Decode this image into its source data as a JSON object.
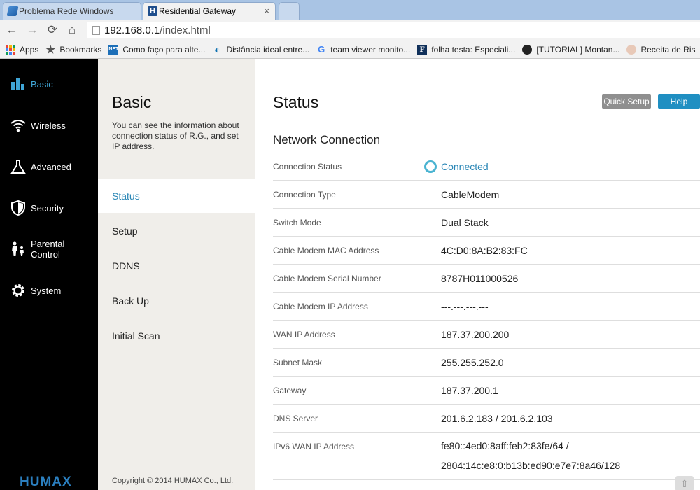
{
  "browser": {
    "tabs": [
      {
        "title": "Problema Rede Windows"
      },
      {
        "title": "Residential Gateway"
      }
    ],
    "url_host": "192.168.0.1",
    "url_path": "/index.html",
    "bookmarks": [
      {
        "label": "Apps"
      },
      {
        "label": "Bookmarks"
      },
      {
        "label": "Como faço para alte..."
      },
      {
        "label": "Distância ideal entre..."
      },
      {
        "label": "team viewer monito..."
      },
      {
        "label": "folha testa: Especiali..."
      },
      {
        "label": "[TUTORIAL] Montan..."
      },
      {
        "label": "Receita de Ris"
      }
    ],
    "nav_icons": {
      "back": "←",
      "forward": "→",
      "reload": "⟳",
      "home": "⌂",
      "close": "×"
    }
  },
  "sidebar": {
    "items": [
      {
        "label": "Basic",
        "icon": "bar-chart-icon"
      },
      {
        "label": "Wireless",
        "icon": "wifi-icon"
      },
      {
        "label": "Advanced",
        "icon": "flask-icon"
      },
      {
        "label": "Security",
        "icon": "shield-icon"
      },
      {
        "label": "Parental Control",
        "icon": "family-icon"
      },
      {
        "label": "System",
        "icon": "gear-icon"
      }
    ],
    "logo": "HUMAX",
    "active_color": "#3fa5d6"
  },
  "subnav": {
    "title": "Basic",
    "description": "You can see the information about connection status of R.G., and set IP address.",
    "items": [
      {
        "label": "Status"
      },
      {
        "label": "Setup"
      },
      {
        "label": "DDNS"
      },
      {
        "label": "Back Up"
      },
      {
        "label": "Initial Scan"
      }
    ],
    "copyright": "Copyright © 2014 HUMAX Co., Ltd."
  },
  "main": {
    "title": "Status",
    "quick_setup_label": "Quick Setup",
    "help_label": "Help",
    "section_title": "Network Connection",
    "rows": [
      {
        "label": "Connection Status",
        "value": "Connected"
      },
      {
        "label": "Connection Type",
        "value": "CableModem"
      },
      {
        "label": "Switch Mode",
        "value": "Dual Stack"
      },
      {
        "label": "Cable Modem MAC Address",
        "value": "4C:D0:8A:B2:83:FC"
      },
      {
        "label": "Cable Modem Serial Number",
        "value": "8787H011000526"
      },
      {
        "label": "Cable Modem IP Address",
        "value": "---.---.---.---"
      },
      {
        "label": "WAN IP Address",
        "value": "187.37.200.200"
      },
      {
        "label": "Subnet Mask",
        "value": "255.255.252.0"
      },
      {
        "label": "Gateway",
        "value": "187.37.200.1"
      },
      {
        "label": "DNS Server",
        "value": "201.6.2.183 / 201.6.2.103"
      },
      {
        "label": "IPv6 WAN IP Address",
        "value_line1": "fe80::4ed0:8aff:feb2:83fe/64 /",
        "value_line2": "2804:14c:e8:0:b13b:ed90:e7e7:8a46/128"
      }
    ],
    "accent_color": "#2b87b6"
  }
}
